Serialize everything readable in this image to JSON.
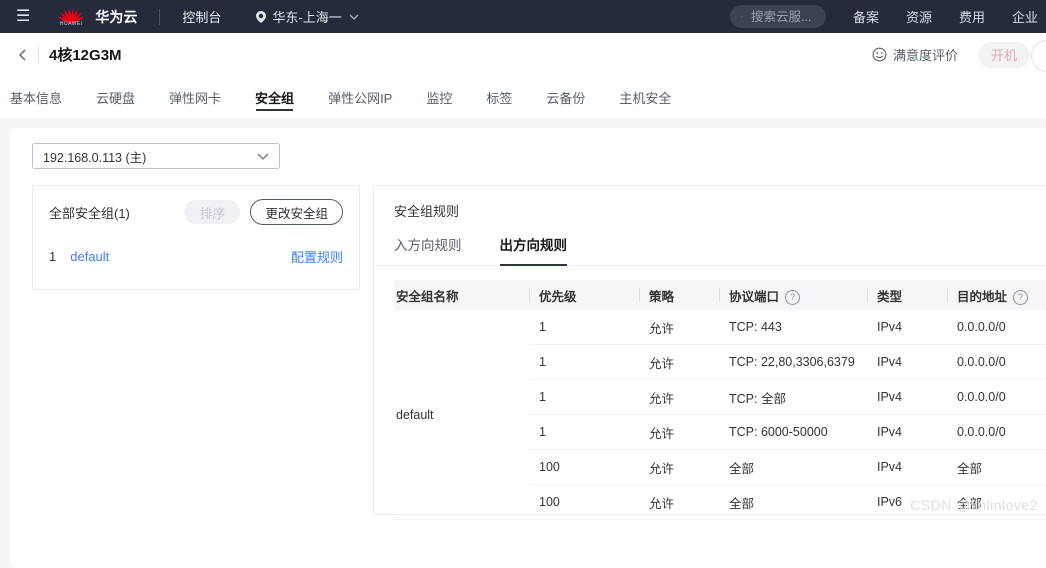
{
  "colors": {
    "topnav_bg": "#252b3a",
    "brand_red": "#e60012",
    "link_blue": "#3d7ff3",
    "active_text": "#181818",
    "muted_text": "#575d6c",
    "power_text": "#dfaaaa",
    "header_bg": "#f5f6f8"
  },
  "topnav": {
    "brand": "华为云",
    "logo_sub": "HUAWEI",
    "console_label": "控制台",
    "region": "华东-上海一",
    "search_placeholder": "搜索云服...",
    "links": [
      "备案",
      "资源",
      "费用",
      "企业"
    ]
  },
  "page_header": {
    "title": "4核12G3M",
    "feedback_label": "满意度评价",
    "power_button": "开机"
  },
  "main_tabs": {
    "items": [
      "基本信息",
      "云硬盘",
      "弹性网卡",
      "安全组",
      "弹性公网IP",
      "监控",
      "标签",
      "云备份",
      "主机安全"
    ],
    "active": "安全组"
  },
  "panel": {
    "nic_selected": "192.168.0.113 (主)",
    "left": {
      "title": "全部安全组(1)",
      "sort_button": "排序",
      "change_button": "更改安全组",
      "items": [
        {
          "index": "1",
          "name": "default",
          "action": "配置规则"
        }
      ]
    },
    "right": {
      "title": "安全组规则",
      "tabs": [
        "入方向规则",
        "出方向规则"
      ],
      "active_tab": "出方向规则",
      "table": {
        "columns": [
          "安全组名称",
          "优先级",
          "策略",
          "协议端口",
          "类型",
          "目的地址"
        ],
        "group_name": "default",
        "rows": [
          {
            "priority": "1",
            "strategy": "允许",
            "protocol": "TCP: 443",
            "type": "IPv4",
            "destination": "0.0.0.0/0"
          },
          {
            "priority": "1",
            "strategy": "允许",
            "protocol": "TCP: 22,80,3306,6379",
            "type": "IPv4",
            "destination": "0.0.0.0/0"
          },
          {
            "priority": "1",
            "strategy": "允许",
            "protocol": "TCP: 全部",
            "type": "IPv4",
            "destination": "0.0.0.0/0"
          },
          {
            "priority": "1",
            "strategy": "允许",
            "protocol": "TCP: 6000-50000",
            "type": "IPv4",
            "destination": "0.0.0.0/0"
          },
          {
            "priority": "100",
            "strategy": "允许",
            "protocol": "全部",
            "type": "IPv4",
            "destination": "全部"
          },
          {
            "priority": "100",
            "strategy": "允许",
            "protocol": "全部",
            "type": "IPv6",
            "destination": "全部"
          }
        ]
      }
    }
  },
  "watermark": "CSDN @linlinlove2"
}
